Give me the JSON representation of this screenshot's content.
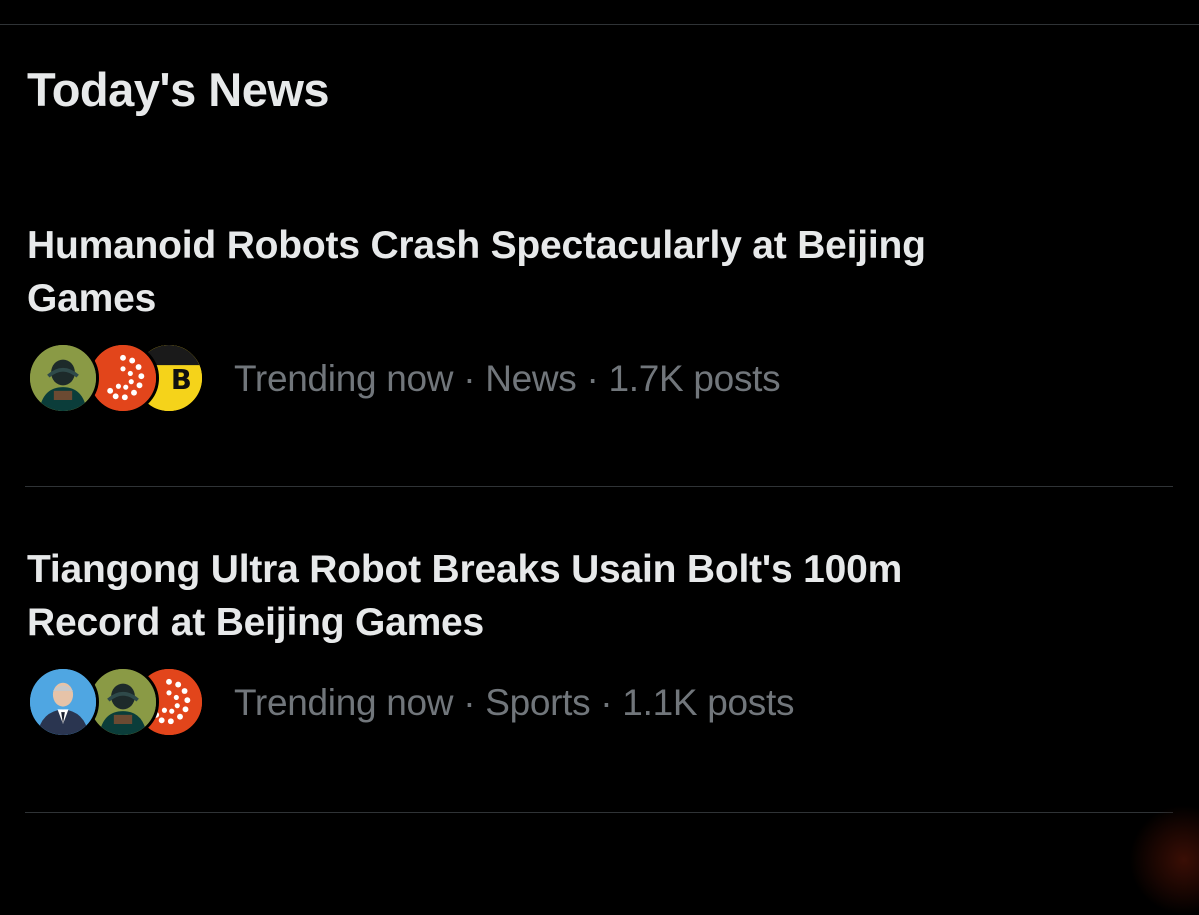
{
  "section": {
    "title": "Today's News"
  },
  "items": [
    {
      "headline": "Humanoid Robots Crash Spectacularly at Beijing Games",
      "meta": "Trending now · News · 1.7K posts",
      "avatars": [
        "player-avatar",
        "dotted-logo-avatar",
        "b-logo-avatar"
      ]
    },
    {
      "headline": "Tiangong Ultra Robot Breaks Usain Bolt's 100m Record at Beijing Games",
      "meta": "Trending now · Sports · 1.1K posts",
      "avatars": [
        "man-in-suit-avatar",
        "player-avatar",
        "dotted-logo-avatar"
      ]
    }
  ],
  "colors": {
    "background": "#000000",
    "text_primary": "#e7e9ea",
    "text_secondary": "#71767b",
    "divider": "#2f3336",
    "logo_orange": "#e2451b",
    "logo_yellow": "#f5d31a"
  }
}
